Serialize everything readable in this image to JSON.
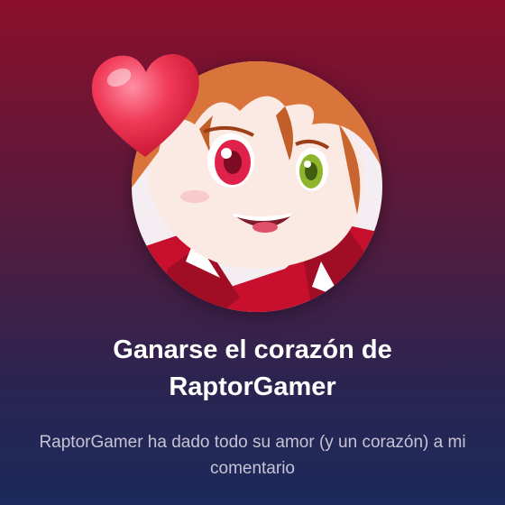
{
  "achievement": {
    "title_line1": "Ganarse el corazón de",
    "title_line2": "RaptorGamer",
    "description": "RaptorGamer ha dado todo su amor (y un corazón) a mi comentario",
    "avatar_icon": "anime-character-avatar",
    "badge_icon": "heart-icon"
  },
  "colors": {
    "background_top": "#8a0e2b",
    "background_bottom": "#1b2a5c",
    "title": "#ffffff",
    "description": "#c7c3d4",
    "heart": "#e8324f"
  }
}
